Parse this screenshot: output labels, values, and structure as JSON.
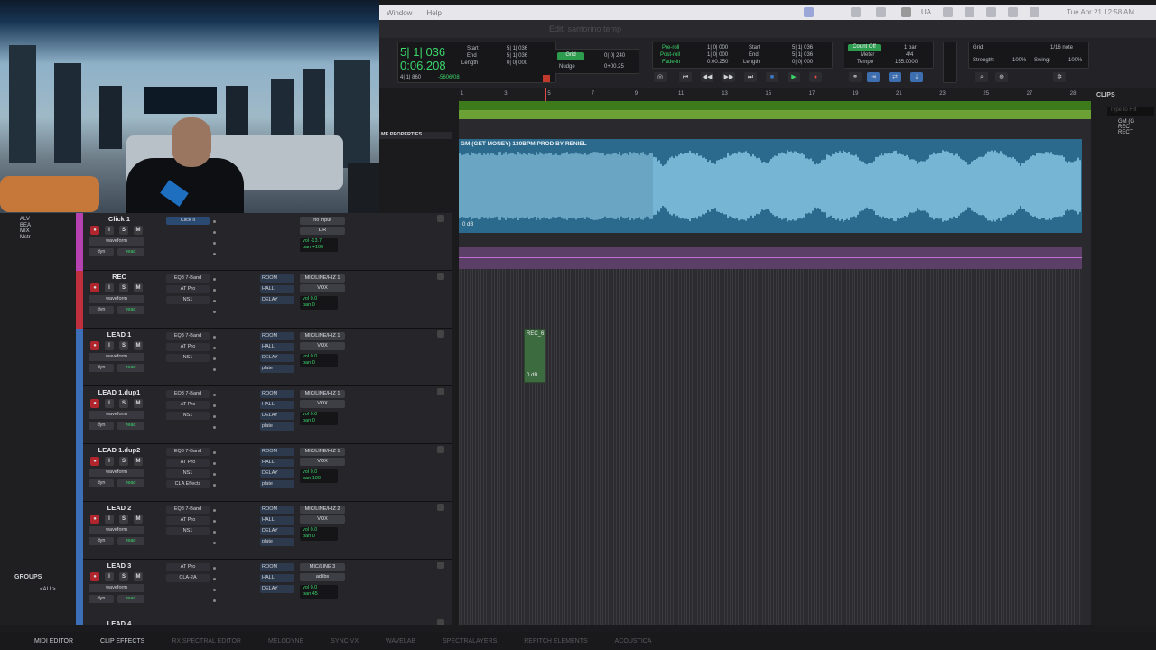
{
  "menubar": {
    "items": [
      "Window",
      "Help"
    ],
    "clock": "Tue Apr 21  12:58 AM",
    "ua": "UA"
  },
  "window_title": "Edit: santorino temp",
  "counter": {
    "main_bars": "5| 1| 036",
    "main_time": "0:06.208",
    "sub": "4| 1| 860",
    "offset": "-5606/08"
  },
  "selection": {
    "start_label": "Start",
    "end_label": "End",
    "length_label": "Length",
    "start": "5| 1| 036",
    "end": "5| 1| 036",
    "length": "0| 0| 000"
  },
  "grid_nudge": {
    "grid_label": "Grid",
    "grid_value": "0| 0| 240",
    "nudge_label": "Nudge",
    "nudge_value": "0+00.25"
  },
  "preroll": {
    "pre": "Pre-roll",
    "post": "Post-roll",
    "fade": "Fade-in",
    "pre_v": "1| 0| 000",
    "post_v": "1| 0| 000",
    "fade_v": "0:00.250"
  },
  "selection2": {
    "start": "5| 1| 036",
    "end": "5| 1| 036",
    "length": "0| 0| 000"
  },
  "metronome": {
    "count": "Count Off",
    "count_v": "1 bar",
    "meter": "Meter",
    "meter_v": "4/4",
    "tempo": "Tempo",
    "tempo_v": "155.0000"
  },
  "gridpanel": {
    "grid": "Grid:",
    "grid_v": "1/16 note",
    "strength": "Strength:",
    "strength_v": "100%",
    "swing": "Swing:",
    "swing_v": "100%"
  },
  "ruler_ticks": [
    "1",
    "3",
    "5",
    "7",
    "9",
    "11",
    "13",
    "15",
    "17",
    "19",
    "21",
    "23",
    "25",
    "27",
    "28"
  ],
  "edit_header": "ME PROPERTIES",
  "clips": {
    "title": "CLIPS",
    "search": "Type to Filt",
    "items": [
      "GM (G",
      "REC_",
      "REC_"
    ]
  },
  "wave_clip": {
    "name": "GM (GET MONEY) 130BPM PROD BY RENIEL",
    "gain": "0 dB"
  },
  "rec_clip": {
    "name": "REC_6",
    "gain": "0 dB"
  },
  "groups": {
    "title": "GROUPS",
    "all": "<ALL>"
  },
  "markers": [
    "ALV",
    "BEA",
    "MIX",
    "Mstr"
  ],
  "tracks": [
    {
      "name": "Click 1",
      "color": "#b641b0",
      "insert": "Click II",
      "io1": "no input",
      "io2": "L/R",
      "vol": "-13.7",
      "pan": "+100",
      "sends": []
    },
    {
      "name": "REC",
      "color": "#c0303c",
      "inserts": [
        "EQ3 7-Band",
        "AT Pro",
        "NS1"
      ],
      "sends": [
        "ROOM",
        "HALL",
        "DELAY"
      ],
      "io1": "MIC/LINE/HIZ 1",
      "io2": "VOX",
      "vol": "0.0",
      "pan": "0"
    },
    {
      "name": "LEAD 1",
      "color": "#3c6fb8",
      "inserts": [
        "EQ3 7-Band",
        "AT Pro",
        "NS1"
      ],
      "sends": [
        "ROOM",
        "HALL",
        "DELAY",
        "plate"
      ],
      "io1": "MIC/LINE/HIZ 1",
      "io2": "VOX",
      "vol": "0.0",
      "pan": "0"
    },
    {
      "name": "LEAD 1.dup1",
      "color": "#3c6fb8",
      "inserts": [
        "EQ3 7-Band",
        "AT Pro",
        "NS1"
      ],
      "sends": [
        "ROOM",
        "HALL",
        "DELAY",
        "plate"
      ],
      "io1": "MIC/LINE/HIZ 1",
      "io2": "VOX",
      "vol": "0.0",
      "pan": "0"
    },
    {
      "name": "LEAD 1.dup2",
      "color": "#3c6fb8",
      "inserts": [
        "EQ3 7-Band",
        "AT Pro",
        "NS1",
        "CLA Effects"
      ],
      "sends": [
        "ROOM",
        "HALL",
        "DELAY",
        "plate"
      ],
      "io1": "MIC/LINE/HIZ 1",
      "io2": "VOX",
      "vol": "0.0",
      "pan": "100"
    },
    {
      "name": "LEAD 2",
      "color": "#3c6fb8",
      "inserts": [
        "EQ3 7-Band",
        "AT Pro",
        "NS1"
      ],
      "sends": [
        "ROOM",
        "HALL",
        "DELAY",
        "plate"
      ],
      "io1": "MIC/LINE/HIZ 2",
      "io2": "VOX",
      "vol": "0.0",
      "pan": "0"
    },
    {
      "name": "LEAD 3",
      "color": "#3c6fb8",
      "inserts": [
        "AT Pro",
        "CLA-2A"
      ],
      "sends": [
        "ROOM",
        "HALL",
        "DELAY"
      ],
      "io1": "MIC/LINE 3",
      "io2": "adlibs",
      "vol": "0.0",
      "pan": "45"
    },
    {
      "name": "LEAD 4",
      "color": "#3c6fb8",
      "inserts": [],
      "sends": [],
      "io1": "",
      "io2": "",
      "vol": "",
      "pan": ""
    }
  ],
  "footer": [
    "MIDI EDITOR",
    "CLIP EFFECTS",
    "RX SPECTRAL EDITOR",
    "MELODYNE",
    "SYNC VX",
    "WAVELAB",
    "SPECTRALAYERS",
    "REPITCH ELEMENTS",
    "ACOUSTICA"
  ],
  "strip_labels": {
    "waveform": "waveform",
    "dyn": "dyn",
    "read": "read",
    "vol": "vol",
    "pan": "pan"
  }
}
